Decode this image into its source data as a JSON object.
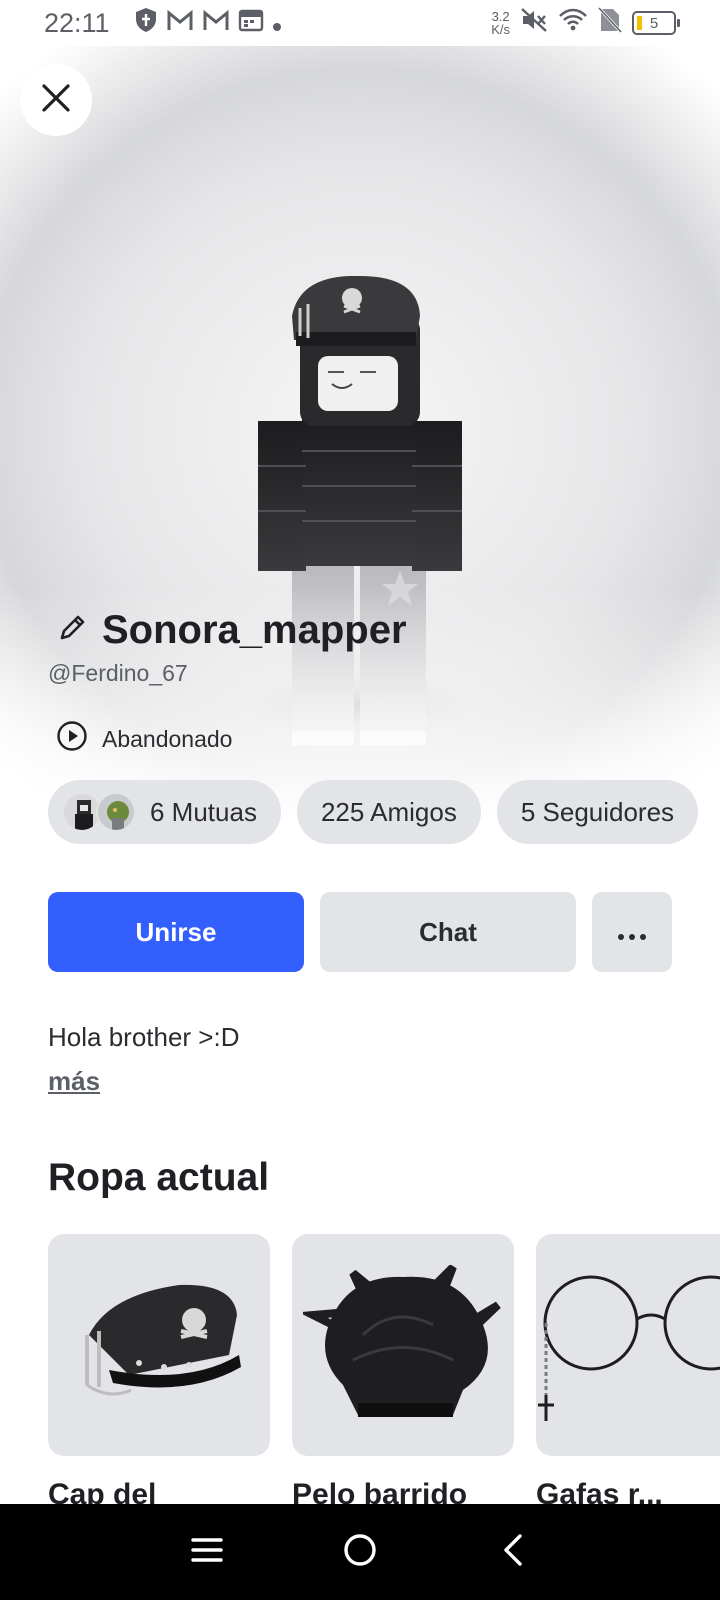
{
  "status_bar": {
    "time": "22:11",
    "net_speed_value": "3.2",
    "net_speed_unit": "K/s",
    "battery_level": "5",
    "icons": [
      "shield-icon",
      "gmail-icon",
      "gmail-icon",
      "calendar-icon",
      "dot-icon",
      "mute-icon",
      "wifi-icon",
      "no-sim-icon",
      "battery-icon"
    ]
  },
  "profile": {
    "display_name": "Sonora_mapper",
    "username": "@Ferdino_67",
    "presence": "Abandonado",
    "bio": "Hola brother >:D",
    "more_label": "más"
  },
  "chips": {
    "mutuals": "6 Mutuas",
    "friends": "225 Amigos",
    "followers": "5 Seguidores"
  },
  "actions": {
    "join_label": "Unirse",
    "chat_label": "Chat",
    "more_label": "···"
  },
  "current_outfit": {
    "title": "Ropa actual",
    "items": [
      {
        "name": "Cap del",
        "icon": "skull-cap-icon"
      },
      {
        "name": "Pelo barrido",
        "icon": "hair-icon"
      },
      {
        "name": "Gafas r...",
        "icon": "glasses-icon"
      }
    ]
  },
  "colors": {
    "accent": "#335fff",
    "chip_bg": "#e3e4e8",
    "text": "#1f2024"
  }
}
